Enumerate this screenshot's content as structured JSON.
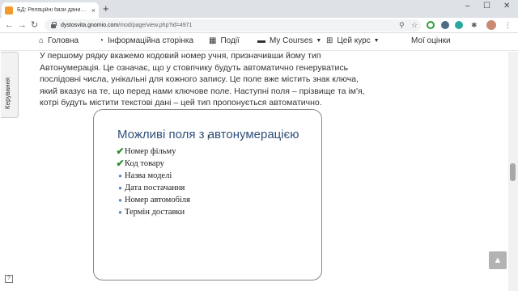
{
  "browser": {
    "tab_title": "БД: Реляційні бази даних. Їхні с",
    "tab_close": "×",
    "new_tab": "+",
    "url_host": "dystosvita.gnomio.com",
    "url_path": "/mod/page/view.php?id=4971",
    "window_minimize": "–",
    "window_maximize": "☐",
    "window_close": "✕"
  },
  "nav": {
    "items": [
      {
        "icon": "home-icon",
        "glyph": "⌂",
        "label": "Головна"
      },
      {
        "icon": "dashboard-icon",
        "glyph": "◔",
        "label": "Інформаційна сторінка"
      },
      {
        "icon": "calendar-icon",
        "glyph": "▦",
        "label": "Події"
      },
      {
        "icon": "briefcase-icon",
        "glyph": "▬",
        "label": "My Courses"
      },
      {
        "icon": "sitemap-icon",
        "glyph": "⊞",
        "label": "Цей курс"
      },
      {
        "icon": "",
        "glyph": "",
        "label": "Мої оцінки"
      }
    ]
  },
  "side_tab": {
    "label": "Керування"
  },
  "content": {
    "paragraph": "У першому рядку вкажемо кодовий номер учня, призначивши йому тип Автонумерація. Це означає, що у стовпчику будуть автоматично генеруватись послідовні числа, унікальні для кожного запису. Це поле вже містить знак ключа, який вказує на те, що перед нами ключове поле. Наступні поля – прізвище та ім'я, котрі будуть містити текстові дані – цей тип пропонується автоматично."
  },
  "slide": {
    "title": "Можливі поля з автонумерацією",
    "items": [
      {
        "marker": "check",
        "text": "Номер фільму"
      },
      {
        "marker": "check",
        "text": "Код товару"
      },
      {
        "marker": "bullet",
        "text": "Назва моделі"
      },
      {
        "marker": "bullet",
        "text": "Дата постачання"
      },
      {
        "marker": "bullet",
        "text": "Номер автомобіля"
      },
      {
        "marker": "bullet",
        "text": "Термін доставки"
      }
    ]
  },
  "back_to_top": "▲",
  "colors": {
    "slide_title": "#2f4f7a",
    "check": "#2e8b2e",
    "bullet": "#5b87b8"
  }
}
